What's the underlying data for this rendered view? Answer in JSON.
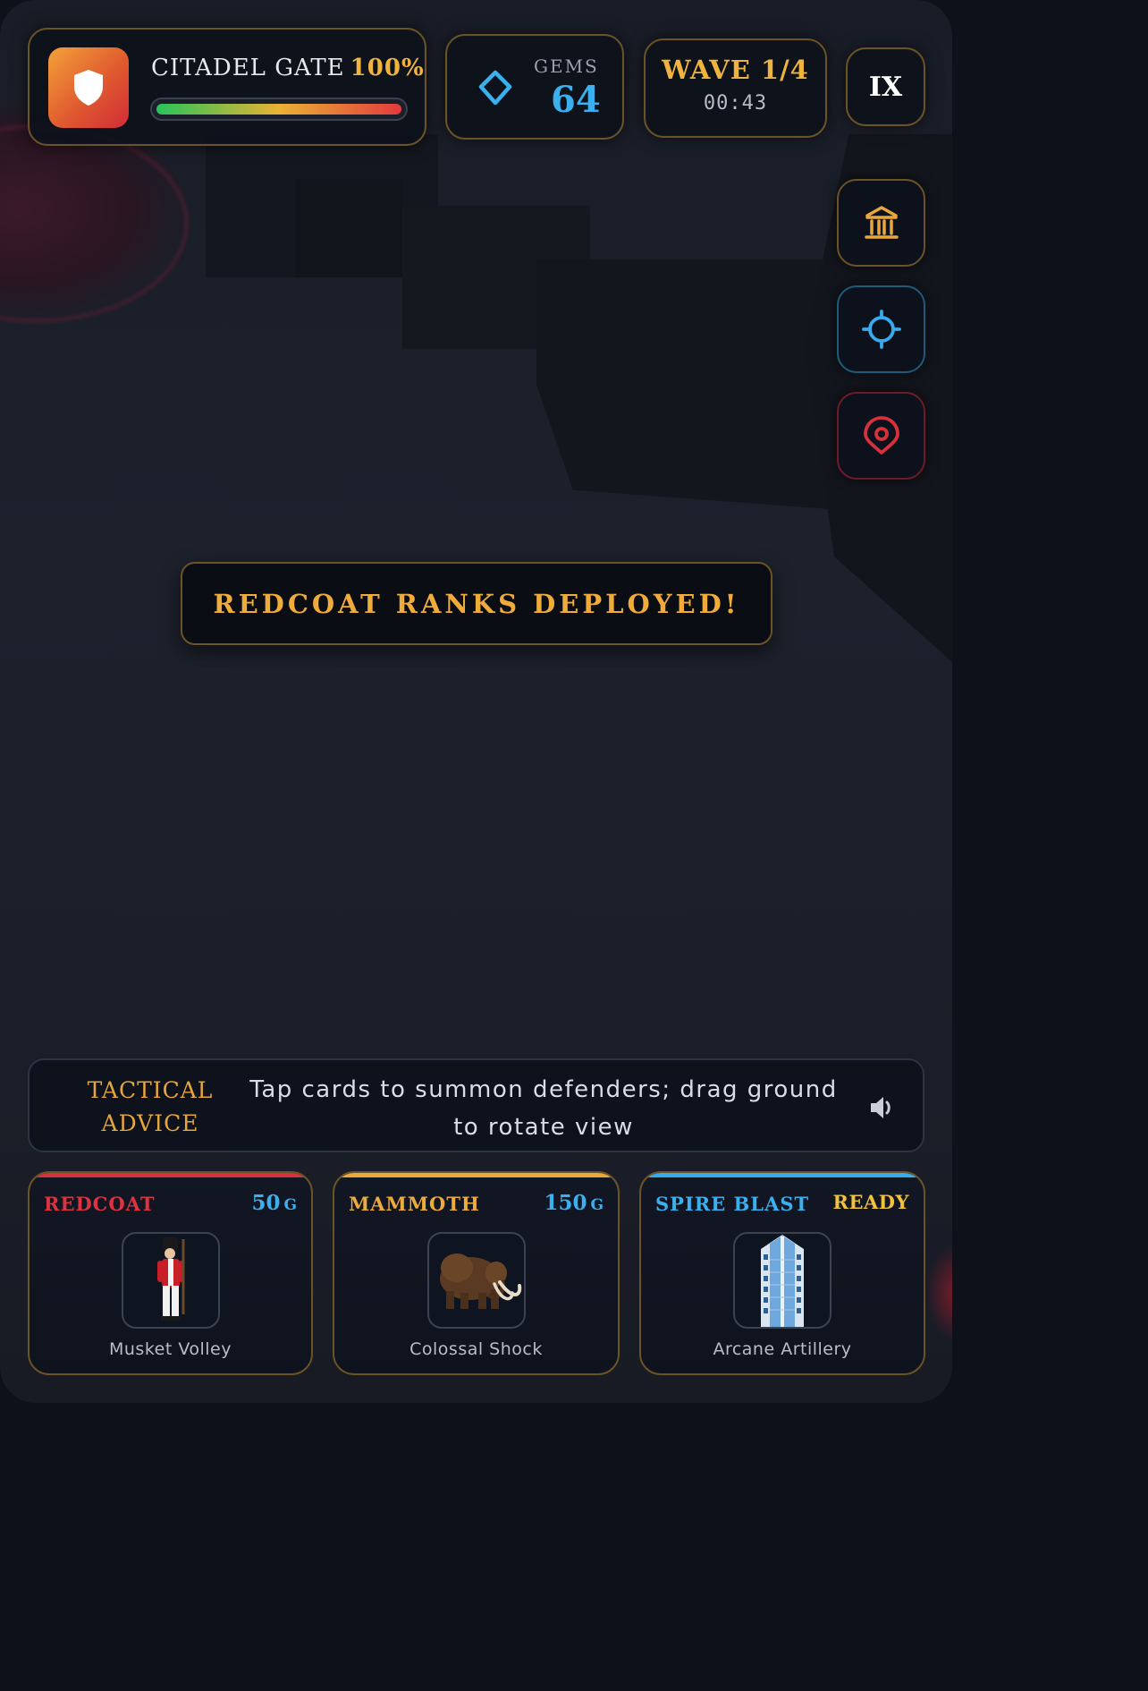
{
  "hud": {
    "gate_name": "CITADEL GATE",
    "gate_health_label": "100%",
    "gate_health": 1.0,
    "gems_label": "GEMS",
    "gems_value": "64",
    "wave_label": "WAVE 1/4",
    "wave_timer": "00:43",
    "rank_badge": "IX"
  },
  "side_buttons": [
    {
      "icon": "building-icon",
      "color": "#e9a93a"
    },
    {
      "icon": "crosshair-icon",
      "color": "#37abec"
    },
    {
      "icon": "location-icon",
      "color": "#d8313e"
    }
  ],
  "banner": {
    "text": "REDCOAT RANKS DEPLOYED!"
  },
  "advice": {
    "label_line1": "TACTICAL",
    "label_line2": "ADVICE",
    "text": "Tap cards to summon defenders; drag ground to rotate view",
    "sound_icon": "speaker-icon"
  },
  "cards": [
    {
      "name": "REDCOAT",
      "cost": "50",
      "cost_unit": "G",
      "subtitle": "Musket Volley",
      "accent": "#d8313e",
      "image": "redcoat-soldier"
    },
    {
      "name": "MAMMOTH",
      "cost": "150",
      "cost_unit": "G",
      "subtitle": "Colossal Shock",
      "accent": "#e9a93a",
      "image": "mammoth"
    },
    {
      "name": "SPIRE BLAST",
      "status": "READY",
      "subtitle": "Arcane Artillery",
      "accent": "#37abec",
      "image": "skyscraper"
    }
  ],
  "colors": {
    "gold": "#f0b43e",
    "blue": "#3ab0ee",
    "red": "#d8313e",
    "background": "#1b1f29"
  }
}
